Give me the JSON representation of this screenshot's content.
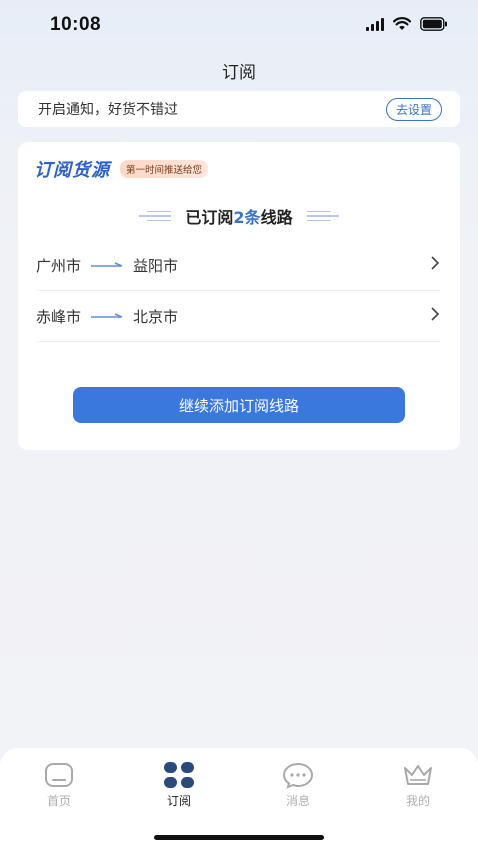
{
  "status_bar": {
    "time": "10:08"
  },
  "page": {
    "title": "订阅"
  },
  "notice": {
    "text": "开启通知，好货不错过",
    "button_label": "去设置"
  },
  "card": {
    "brand": "订阅货源",
    "tag": "第一时间推送给您",
    "summary_prefix": "已订阅",
    "summary_count": "2条",
    "summary_suffix": "线路",
    "routes": [
      {
        "from": "广州市",
        "to": "益阳市"
      },
      {
        "from": "赤峰市",
        "to": "北京市"
      }
    ],
    "add_button_label": "继续添加订阅线路"
  },
  "tabs": [
    {
      "label": "首页",
      "icon": "home-icon",
      "active": false
    },
    {
      "label": "订阅",
      "icon": "subscribe-icon",
      "active": true
    },
    {
      "label": "消息",
      "icon": "message-icon",
      "active": false
    },
    {
      "label": "我的",
      "icon": "crown-icon",
      "active": false
    }
  ],
  "colors": {
    "accent": "#3a78de",
    "brand": "#2e62c9",
    "inactive_tab": "#b0b0b0"
  }
}
